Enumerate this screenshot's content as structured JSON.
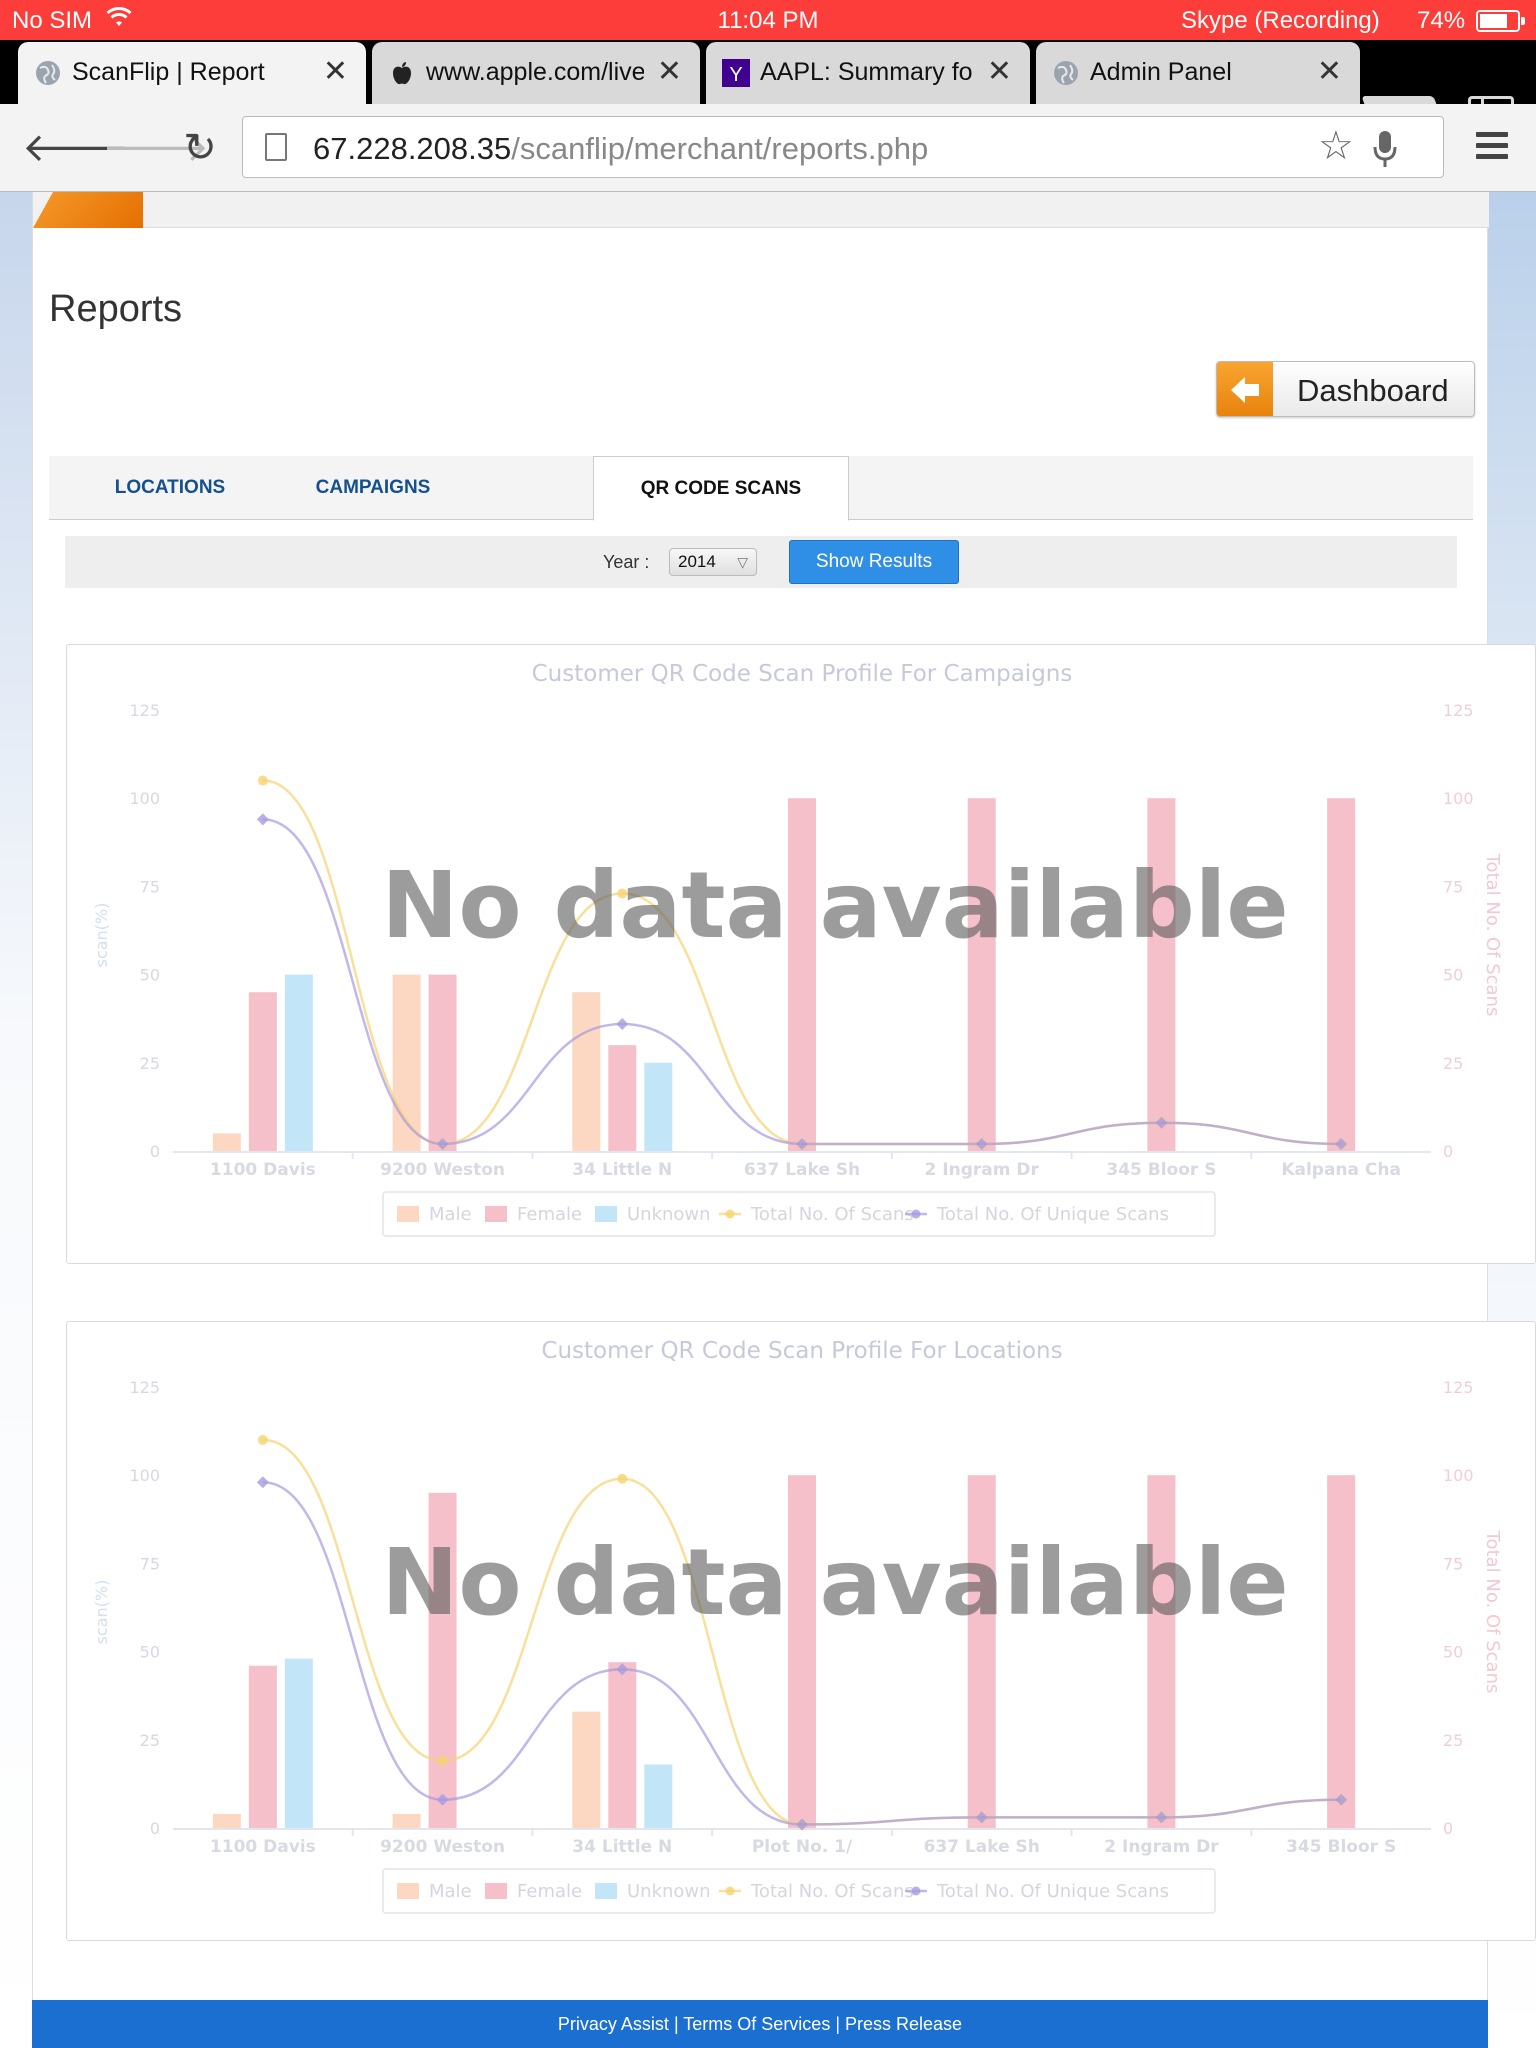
{
  "status_bar": {
    "carrier": "No SIM",
    "time": "11:04 PM",
    "recording": "Skype (Recording)",
    "battery": "74%",
    "battery_level": 0.74
  },
  "tabs": [
    {
      "title": "ScanFlip | Report",
      "icon": "globe-icon"
    },
    {
      "title": "www.apple.com/live/",
      "icon": "apple-icon"
    },
    {
      "title": "AAPL: Summary for A",
      "icon": "yahoo-icon"
    },
    {
      "title": "Admin Panel",
      "icon": "globe-icon"
    }
  ],
  "toolbar": {
    "url_host": "67.228.208.35",
    "url_path": "/scanflip/merchant/reports.php"
  },
  "page": {
    "title": "Reports",
    "dashboard_label": "Dashboard",
    "report_tabs": [
      "LOCATIONS",
      "CAMPAIGNS",
      "QR CODE SCANS"
    ],
    "active_tab": "QR CODE SCANS",
    "year_label": "Year :",
    "year_value": "2014",
    "show_results": "Show Results",
    "no_data": "No data available"
  },
  "colors": {
    "male": "#f9b890",
    "female": "#ec8d9e",
    "unknown": "#8fd2f0",
    "total": "#f6d36f",
    "unique": "#a79ae0",
    "accent": "#2f8fe6",
    "footer": "#1a6fd0"
  },
  "chart_data": [
    {
      "type": "bar",
      "title": "Customer QR Code Scan Profile For Campaigns",
      "ylabel": "scan(%)",
      "y2label": "Total No. Of Scans",
      "ylim": [
        0,
        125
      ],
      "y2lim": [
        0,
        125
      ],
      "yticks": [
        0,
        25,
        50,
        75,
        100,
        125
      ],
      "categories": [
        "1100 Davis",
        "9200 Weston",
        "34 Little N",
        "637 Lake Sh",
        "2 Ingram Dr",
        "345 Bloor S",
        "Kalpana Cha"
      ],
      "series": [
        {
          "name": "Male",
          "type": "bar",
          "values": [
            5,
            50,
            45,
            0,
            0,
            0,
            0
          ]
        },
        {
          "name": "Female",
          "type": "bar",
          "values": [
            45,
            50,
            30,
            100,
            100,
            100,
            100
          ]
        },
        {
          "name": "Unknown",
          "type": "bar",
          "values": [
            50,
            0,
            25,
            0,
            0,
            0,
            0
          ]
        },
        {
          "name": "Total No. Of Scans",
          "type": "line",
          "values": [
            105,
            2,
            73,
            2,
            2,
            8,
            2
          ]
        },
        {
          "name": "Total No. Of Unique Scans",
          "type": "line",
          "values": [
            94,
            2,
            36,
            2,
            2,
            8,
            2
          ]
        }
      ],
      "legend": "bottom",
      "overlay": "No data available"
    },
    {
      "type": "bar",
      "title": "Customer QR Code Scan Profile For Locations",
      "ylabel": "scan(%)",
      "y2label": "Total No. Of Scans",
      "ylim": [
        0,
        125
      ],
      "y2lim": [
        0,
        125
      ],
      "yticks": [
        0,
        25,
        50,
        75,
        100,
        125
      ],
      "categories": [
        "1100 Davis",
        "9200 Weston",
        "34 Little N",
        "Plot No. 1/",
        "637 Lake Sh",
        "2 Ingram Dr",
        "345 Bloor S"
      ],
      "series": [
        {
          "name": "Male",
          "type": "bar",
          "values": [
            4,
            4,
            33,
            0,
            0,
            0,
            0
          ]
        },
        {
          "name": "Female",
          "type": "bar",
          "values": [
            46,
            95,
            47,
            100,
            100,
            100,
            100
          ]
        },
        {
          "name": "Unknown",
          "type": "bar",
          "values": [
            48,
            0,
            18,
            0,
            0,
            0,
            0
          ]
        },
        {
          "name": "Total No. Of Scans",
          "type": "line",
          "values": [
            110,
            19,
            99,
            1,
            3,
            3,
            8
          ]
        },
        {
          "name": "Total No. Of Unique Scans",
          "type": "line",
          "values": [
            98,
            8,
            45,
            1,
            3,
            3,
            8
          ]
        }
      ],
      "legend": "bottom",
      "overlay": "No data available"
    }
  ],
  "footer": {
    "privacy": "Privacy Assist",
    "terms": "Terms Of Services",
    "press": "Press Release",
    "sep": " | "
  }
}
